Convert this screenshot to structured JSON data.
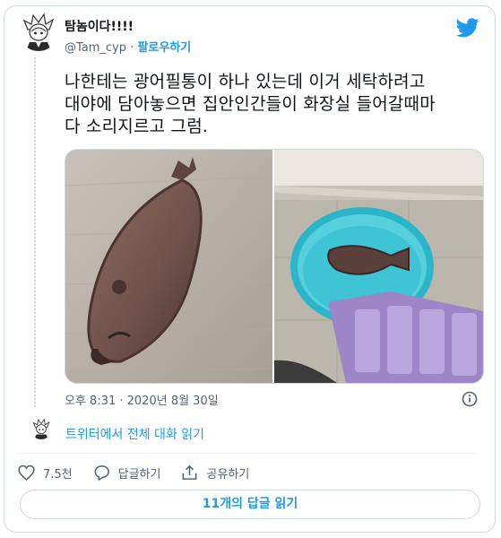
{
  "author": {
    "name": "탐놈이다!!!!",
    "handle": "@Tam_cyp",
    "separator": "·",
    "follow_label": "팔로우하기"
  },
  "tweet": {
    "text": "나한테는 광어필통이 하나 있는데 이거 세탁하려고\n대야에 담아놓으면 집안인간들이 화장실 들어갈때마\n다 소리지르고 그럼.",
    "timestamp": "오후 8:31 · 2020년 8월 30일"
  },
  "thread": {
    "read_label": "트위터에서 전체 대화 읽기"
  },
  "actions": {
    "like_count": "7.5천",
    "reply_label": "답글하기",
    "share_label": "공유하기"
  },
  "replies_button": "11개의 답글 읽기",
  "colors": {
    "accent": "#1d9bf0",
    "muted": "#536471",
    "border": "#cfd9de",
    "like_icon": "#536471"
  },
  "icons": [
    "avatar-illustration",
    "twitter-bird-icon",
    "info-icon",
    "heart-icon",
    "reply-icon",
    "share-icon"
  ]
}
